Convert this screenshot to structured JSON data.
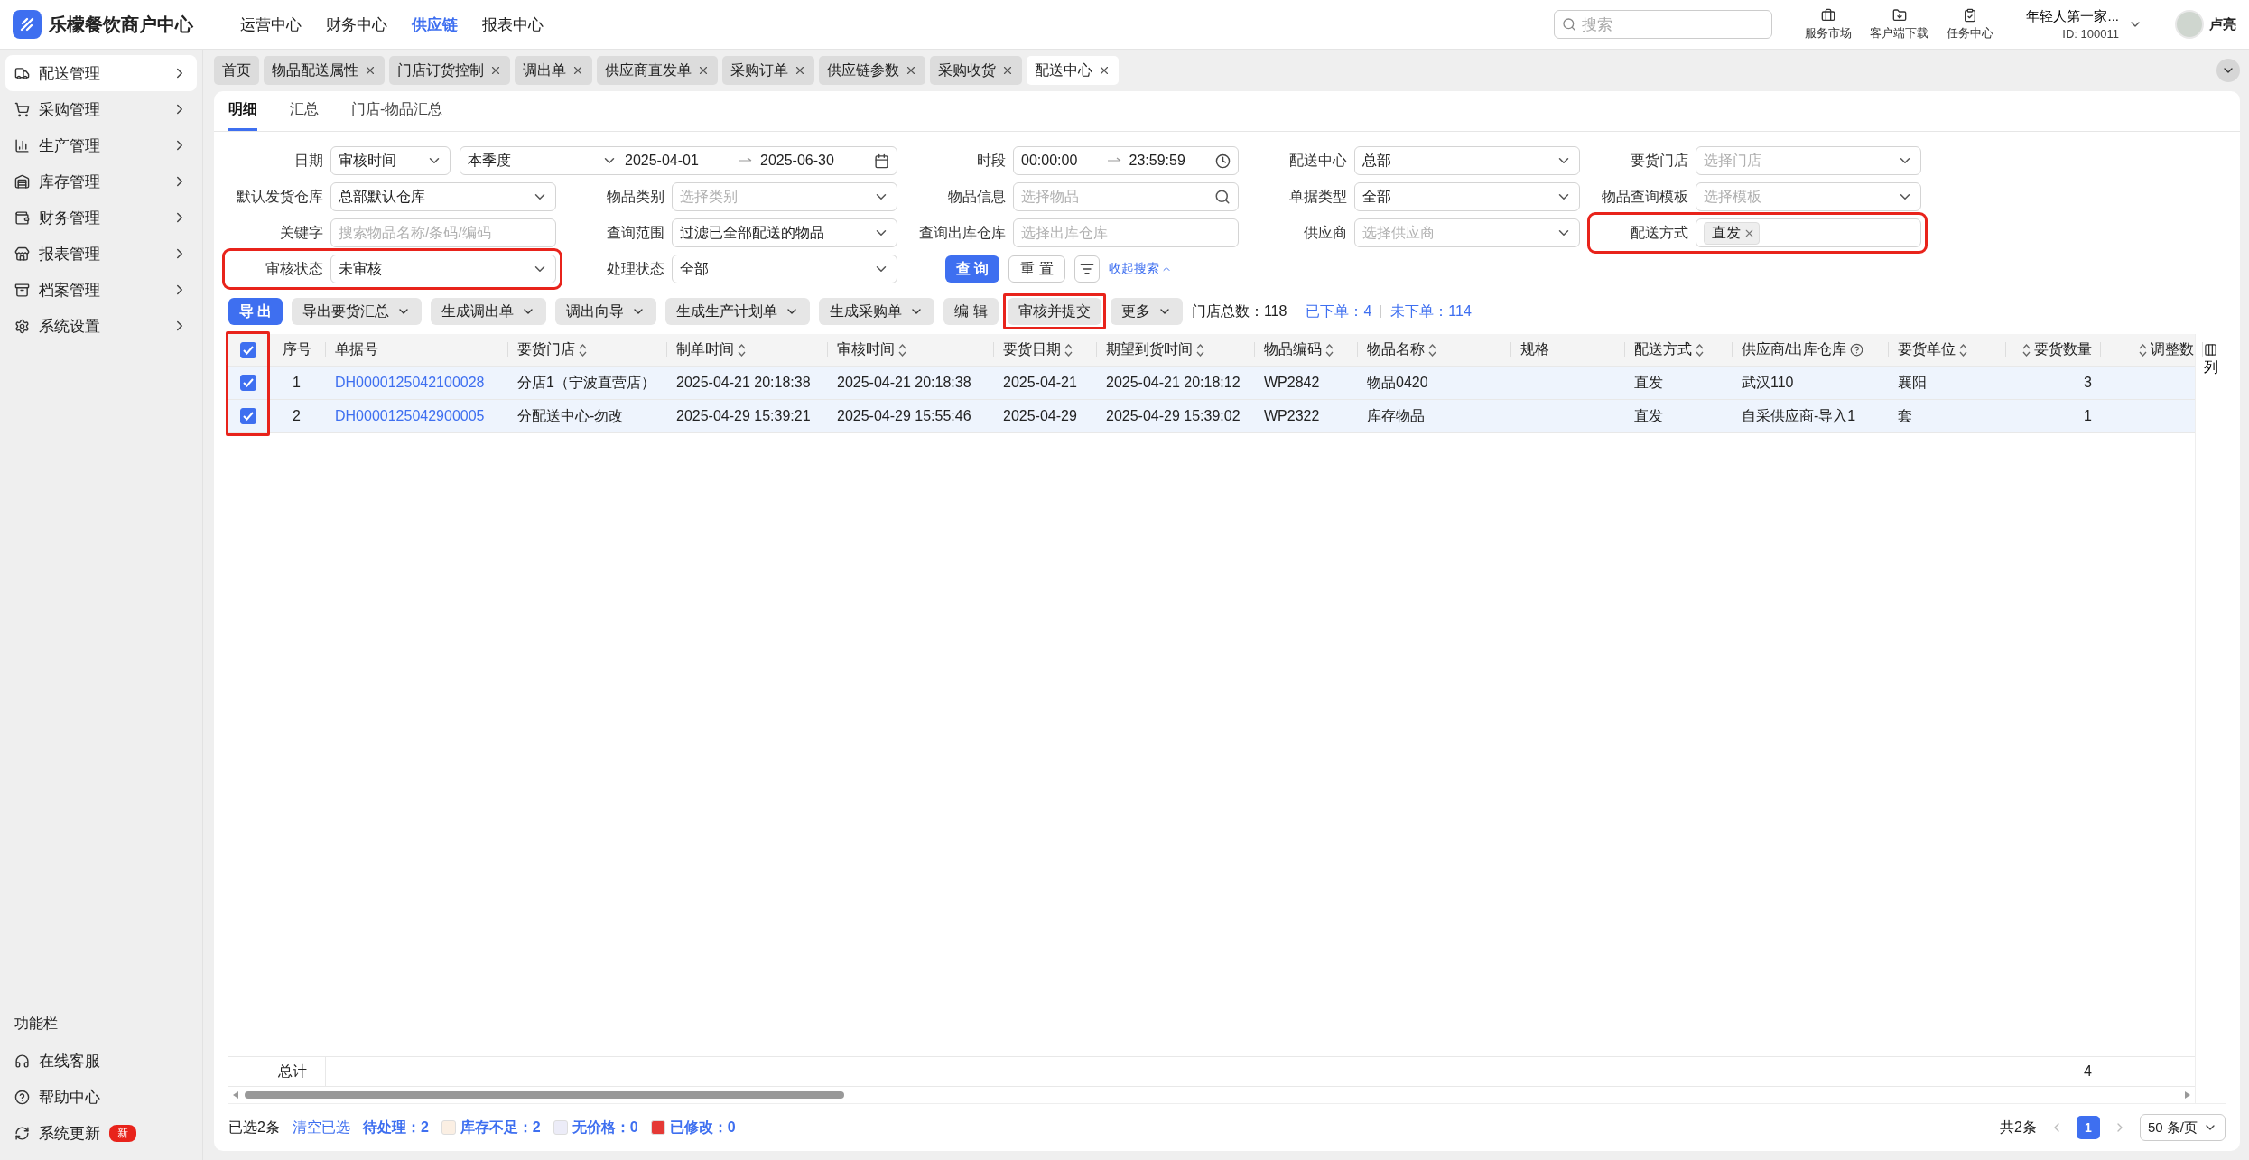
{
  "topbar": {
    "brand": "乐檬餐饮商户中心",
    "nav": [
      {
        "label": "运营中心",
        "selected": false
      },
      {
        "label": "财务中心",
        "selected": false
      },
      {
        "label": "供应链",
        "selected": true
      },
      {
        "label": "报表中心",
        "selected": false
      }
    ],
    "search": {
      "placeholder": "搜索"
    },
    "shortcuts": [
      "服务市场",
      "客户端下载",
      "任务中心"
    ],
    "account": {
      "name": "年轻人第一家...",
      "id": "ID: 100011"
    },
    "user": "卢亮"
  },
  "sidebar": {
    "items": [
      {
        "label": "配送管理",
        "selected": true
      },
      {
        "label": "采购管理",
        "selected": false
      },
      {
        "label": "生产管理",
        "selected": false
      },
      {
        "label": "库存管理",
        "selected": false
      },
      {
        "label": "财务管理",
        "selected": false
      },
      {
        "label": "报表管理",
        "selected": false
      },
      {
        "label": "档案管理",
        "selected": false
      },
      {
        "label": "系统设置",
        "selected": false
      }
    ],
    "footer_title": "功能栏",
    "footer_items": [
      {
        "label": "在线客服"
      },
      {
        "label": "帮助中心"
      },
      {
        "label": "系统更新",
        "badge": "新"
      }
    ]
  },
  "tabs": [
    {
      "label": "首页",
      "selected": false,
      "closable": false
    },
    {
      "label": "物品配送属性",
      "selected": false,
      "closable": true
    },
    {
      "label": "门店订货控制",
      "selected": false,
      "closable": true
    },
    {
      "label": "调出单",
      "selected": false,
      "closable": true
    },
    {
      "label": "供应商直发单",
      "selected": false,
      "closable": true
    },
    {
      "label": "采购订单",
      "selected": false,
      "closable": true
    },
    {
      "label": "供应链参数",
      "selected": false,
      "closable": true
    },
    {
      "label": "采购收货",
      "selected": false,
      "closable": true
    },
    {
      "label": "配送中心",
      "selected": true,
      "closable": true
    }
  ],
  "subtabs": [
    {
      "label": "明细",
      "selected": true
    },
    {
      "label": "汇总",
      "selected": false
    },
    {
      "label": "门店-物品汇总",
      "selected": false
    }
  ],
  "filters": {
    "rows": [
      [
        {
          "label": "日期",
          "kind": "date_range",
          "type_value": "审核时间",
          "preset": "本季度",
          "start": "2025-04-01",
          "end": "2025-06-30",
          "highlighted": false
        },
        "",
        {
          "label": "时段",
          "kind": "time_range",
          "start": "00:00:00",
          "end": "23:59:59",
          "highlighted": false
        },
        {
          "label": "配送中心",
          "kind": "select",
          "value": "总部",
          "highlighted": false
        },
        {
          "label": "要货门店",
          "kind": "select",
          "placeholder": "选择门店",
          "highlighted": false
        }
      ],
      [
        {
          "label": "默认发货仓库",
          "kind": "select",
          "value": "总部默认仓库",
          "highlighted": false
        },
        {
          "label": "物品类别",
          "kind": "select",
          "placeholder": "选择类别",
          "highlighted": false
        },
        {
          "label": "物品信息",
          "kind": "search",
          "placeholder": "选择物品",
          "highlighted": false
        },
        {
          "label": "单据类型",
          "kind": "select",
          "value": "全部",
          "highlighted": false
        },
        {
          "label": "物品查询模板",
          "kind": "select",
          "placeholder": "选择模板",
          "highlighted": false
        }
      ],
      [
        {
          "label": "关键字",
          "kind": "input",
          "placeholder": "搜索物品名称/条码/编码",
          "highlighted": false
        },
        {
          "label": "查询范围",
          "kind": "select",
          "value": "过滤已全部配送的物品",
          "highlighted": false
        },
        {
          "label": "查询出库仓库",
          "kind": "input",
          "placeholder": "选择出库仓库",
          "highlighted": false
        },
        {
          "label": "供应商",
          "kind": "select",
          "placeholder": "选择供应商",
          "highlighted": false
        },
        {
          "label": "配送方式",
          "kind": "tags",
          "tags": [
            "直发"
          ],
          "highlighted": true
        }
      ],
      [
        {
          "label": "审核状态",
          "kind": "select",
          "value": "未审核",
          "highlighted": true
        },
        {
          "label": "处理状态",
          "kind": "select",
          "value": "全部",
          "highlighted": false
        }
      ]
    ],
    "actions": {
      "search": "查 询",
      "reset": "重 置",
      "collapse": "收起搜索"
    }
  },
  "toolbar": {
    "buttons": [
      {
        "label": "导 出",
        "kind": "primary",
        "highlighted": false
      },
      {
        "label": "导出要货汇总",
        "kind": "dropdown",
        "highlighted": false
      },
      {
        "label": "生成调出单",
        "kind": "dropdown",
        "highlighted": false
      },
      {
        "label": "调出向导",
        "kind": "dropdown",
        "highlighted": false
      },
      {
        "label": "生成生产计划单",
        "kind": "dropdown",
        "highlighted": false
      },
      {
        "label": "生成采购单",
        "kind": "dropdown",
        "highlighted": false
      },
      {
        "label": "编 辑",
        "kind": "plain",
        "highlighted": false
      },
      {
        "label": "审核并提交",
        "kind": "plain",
        "highlighted": true
      },
      {
        "label": "更多",
        "kind": "dropdown",
        "highlighted": false
      }
    ],
    "stats": [
      {
        "text": "门店总数：118",
        "kind": "plain"
      },
      {
        "text": "已下单：4",
        "kind": "link"
      },
      {
        "text": "未下单：114",
        "kind": "link"
      }
    ]
  },
  "table": {
    "all_checked": true,
    "checkbox_highlighted": true,
    "columns": [
      {
        "label": "序号",
        "sortable": false,
        "kind": "text"
      },
      {
        "label": "单据号",
        "sortable": false,
        "kind": "link"
      },
      {
        "label": "要货门店",
        "sortable": true,
        "kind": "text"
      },
      {
        "label": "制单时间",
        "sortable": true,
        "kind": "text"
      },
      {
        "label": "审核时间",
        "sortable": true,
        "kind": "text"
      },
      {
        "label": "要货日期",
        "sortable": true,
        "kind": "text"
      },
      {
        "label": "期望到货时间",
        "sortable": true,
        "kind": "text"
      },
      {
        "label": "物品编码",
        "sortable": true,
        "kind": "text"
      },
      {
        "label": "物品名称",
        "sortable": true,
        "kind": "text"
      },
      {
        "label": "规格",
        "sortable": false,
        "kind": "text"
      },
      {
        "label": "配送方式",
        "sortable": true,
        "kind": "text"
      },
      {
        "label": "供应商/出库仓库",
        "sortable": false,
        "kind": "text",
        "help": true
      },
      {
        "label": "要货单位",
        "sortable": true,
        "kind": "text"
      },
      {
        "label": "要货数量",
        "sortable": true,
        "kind": "text"
      },
      {
        "label": "调整数",
        "sortable": true,
        "kind": "text"
      }
    ],
    "rows": [
      {
        "checked": true,
        "cells": [
          "1",
          "DH0000125042100028",
          "分店1（宁波直营店）",
          "2025-04-21 20:18:38",
          "2025-04-21 20:18:38",
          "2025-04-21",
          "2025-04-21 20:18:12",
          "WP2842",
          "物品0420",
          null,
          "直发",
          "武汉110",
          "襄阳",
          "3",
          null
        ]
      },
      {
        "checked": true,
        "cells": [
          "2",
          "DH0000125042900005",
          "分配送中心-勿改",
          "2025-04-29 15:39:21",
          "2025-04-29 15:55:46",
          "2025-04-29",
          "2025-04-29 15:39:02",
          "WP2322",
          "库存物品",
          null,
          "直发",
          "自采供应商-导入1",
          "套",
          "1",
          null
        ]
      }
    ],
    "total": {
      "label": "总计",
      "cells": [
        null,
        null,
        null,
        null,
        null,
        null,
        null,
        null,
        null,
        null,
        null,
        null,
        "4",
        null
      ]
    },
    "column_settings": "列"
  },
  "footer": {
    "selected": "已选2条",
    "clear": "清空已选",
    "pending": "待处理：2",
    "legend": [
      {
        "label": "库存不足：2",
        "color": "#fbefe3"
      },
      {
        "label": "无价格：0",
        "color": "#ececf8"
      },
      {
        "label": "已修改：0",
        "color": "#e53935"
      }
    ],
    "total": "共2条",
    "pages": [
      {
        "label": "1",
        "selected": true
      }
    ],
    "page_size": "50 条/页"
  }
}
